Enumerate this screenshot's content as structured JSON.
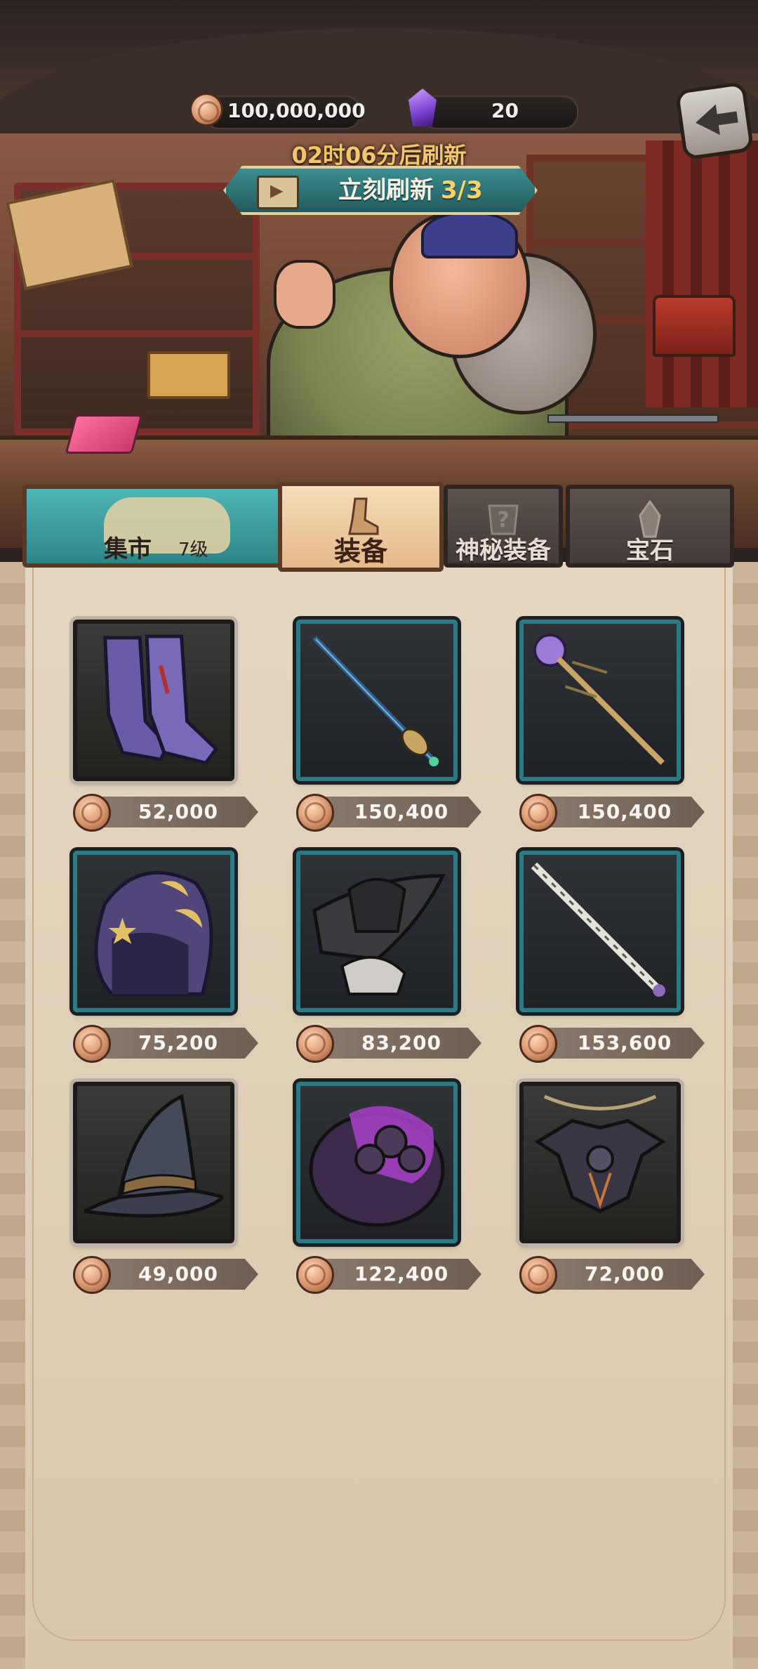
{
  "hud": {
    "coins": "100,000,000",
    "gems": "20"
  },
  "refresh": {
    "timer": "02时06分后刷新",
    "button_label": "立刻刷新",
    "count": "3/3"
  },
  "market": {
    "label": "集市",
    "level": "7级"
  },
  "tabs": [
    {
      "label": "装备",
      "active": true
    },
    {
      "label": "神秘装备",
      "active": false
    },
    {
      "label": "宝石",
      "active": false
    }
  ],
  "items": [
    {
      "name": "purple-boots",
      "price": "52,000",
      "frame": "gray"
    },
    {
      "name": "blue-wand",
      "price": "150,400",
      "frame": "teal"
    },
    {
      "name": "orb-staff",
      "price": "150,400",
      "frame": "teal"
    },
    {
      "name": "crescent-hood",
      "price": "75,200",
      "frame": "teal"
    },
    {
      "name": "black-tricorn-hat",
      "price": "83,200",
      "frame": "teal"
    },
    {
      "name": "bone-wand",
      "price": "153,600",
      "frame": "teal"
    },
    {
      "name": "wizard-hat",
      "price": "49,000",
      "frame": "gray"
    },
    {
      "name": "purple-gauntlet",
      "price": "122,400",
      "frame": "teal"
    },
    {
      "name": "bat-amulet",
      "price": "72,000",
      "frame": "gray"
    }
  ]
}
